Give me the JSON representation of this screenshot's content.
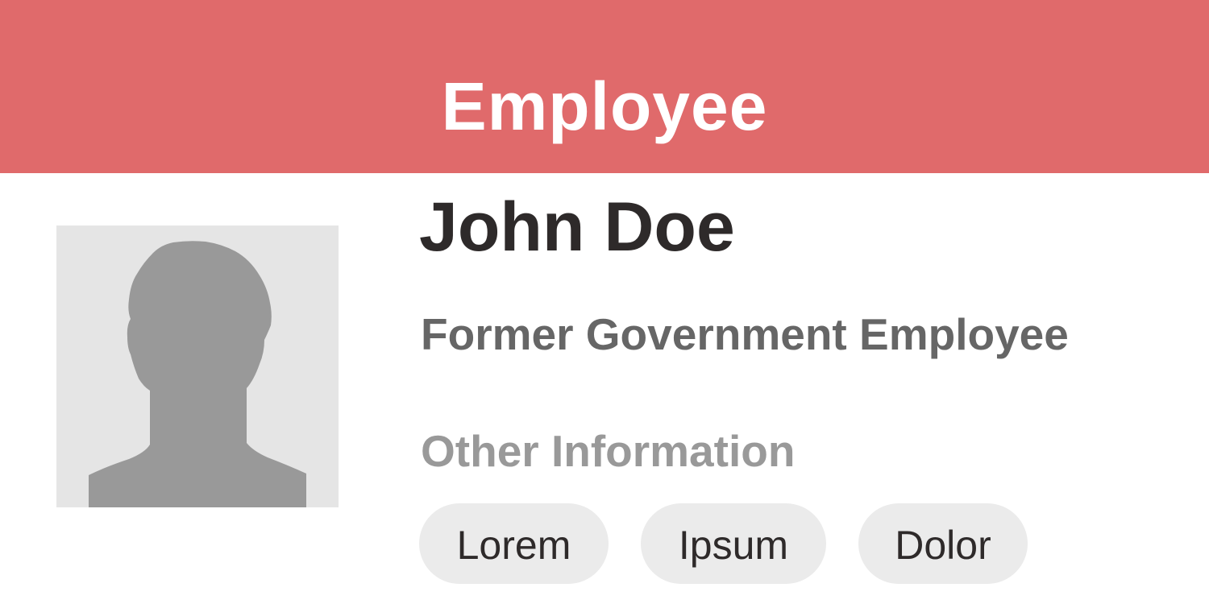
{
  "header": {
    "title": "Employee"
  },
  "profile": {
    "avatar_icon": "person-silhouette-icon",
    "name": "John Doe",
    "role": "Former Government Employee"
  },
  "other_info": {
    "label": "Other Information",
    "tags": [
      "Lorem",
      "Ipsum",
      "Dolor"
    ]
  },
  "colors": {
    "header_bg": "#e06a6b",
    "header_text": "#ffffff",
    "name_text": "#2e2a2a",
    "role_text": "#666666",
    "label_text": "#999999",
    "tag_bg": "#ebebeb",
    "avatar_bg": "#e5e5e5",
    "avatar_silhouette": "#999999"
  }
}
